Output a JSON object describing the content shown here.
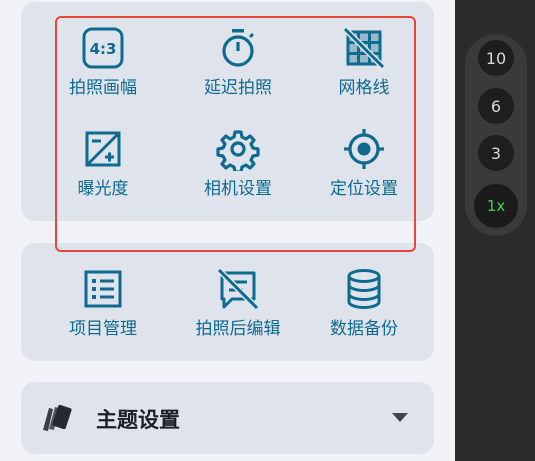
{
  "camera_grid": {
    "items": [
      {
        "label": "拍照画幅",
        "icon": "aspect-ratio-icon",
        "icon_text": "4:3"
      },
      {
        "label": "延迟拍照",
        "icon": "timer-icon"
      },
      {
        "label": "网格线",
        "icon": "grid-off-icon"
      },
      {
        "label": "曝光度",
        "icon": "exposure-icon"
      },
      {
        "label": "相机设置",
        "icon": "gear-icon"
      },
      {
        "label": "定位设置",
        "icon": "gps-target-icon"
      }
    ]
  },
  "project_grid": {
    "items": [
      {
        "label": "项目管理",
        "icon": "list-icon"
      },
      {
        "label": "拍照后编辑",
        "icon": "edit-off-icon"
      },
      {
        "label": "数据备份",
        "icon": "database-icon"
      }
    ]
  },
  "theme": {
    "title": "主题设置",
    "icon": "palette-cards-icon"
  },
  "zoom": {
    "levels": [
      "10",
      "6",
      "3",
      "1x"
    ],
    "active": "1x"
  },
  "colors": {
    "accent": "#0f6a8f",
    "highlight": "#e8473a",
    "card": "#dfe4ec",
    "zoom_active": "#3fd34c"
  }
}
